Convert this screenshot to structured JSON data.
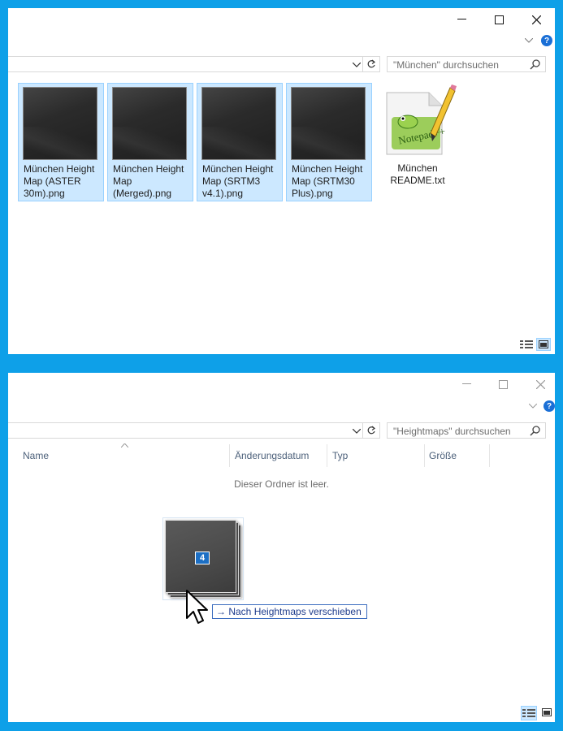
{
  "window1": {
    "search_placeholder": "\"München\" durchsuchen",
    "help_label": "?",
    "files": [
      {
        "name": "München Height Map (ASTER 30m).png",
        "selected": true,
        "type": "image"
      },
      {
        "name": "München Height Map (Merged).png",
        "selected": true,
        "type": "image"
      },
      {
        "name": "München Height Map (SRTM3 v4.1).png",
        "selected": true,
        "type": "image"
      },
      {
        "name": "München Height Map (SRTM30 Plus).png",
        "selected": true,
        "type": "image"
      },
      {
        "name": "München README.txt",
        "selected": false,
        "type": "notepad++"
      }
    ],
    "notepad_logo_text": "Notepad++"
  },
  "window2": {
    "search_placeholder": "\"Heightmaps\" durchsuchen",
    "help_label": "?",
    "columns": [
      "Name",
      "Änderungsdatum",
      "Typ",
      "Größe"
    ],
    "empty_message": "Dieser Ordner ist leer.",
    "drag_count": "4",
    "drag_tooltip": "Nach Heightmaps verschieben",
    "drag_tooltip_arrow": "→"
  },
  "colors": {
    "desktop": "#0ea0e8",
    "selection_fill": "#cce8ff",
    "selection_border": "#99d1ff"
  }
}
